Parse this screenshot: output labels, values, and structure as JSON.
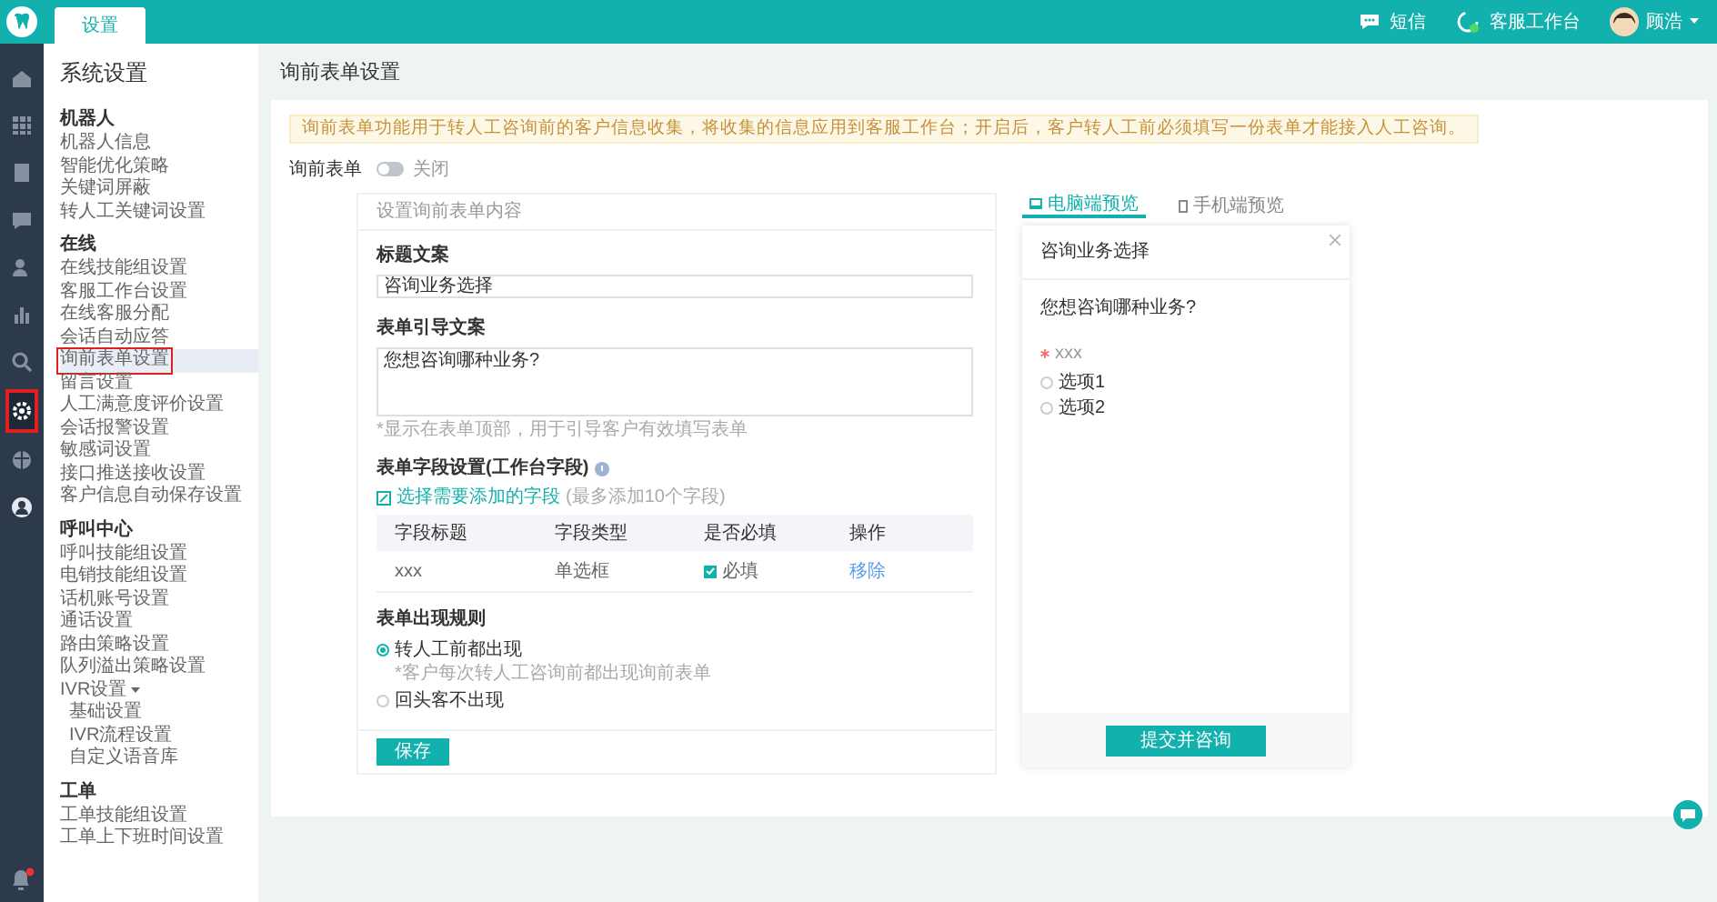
{
  "top_bar": {
    "tabs": [
      {
        "label": "设置",
        "selected": true
      }
    ],
    "actions": [
      {
        "label": "短信",
        "kind": "message"
      },
      {
        "label": "客服工作台",
        "kind": "workbench"
      }
    ],
    "user": {
      "name": "顾浩"
    }
  },
  "icon_rail": {
    "items": [
      {
        "kind": "home",
        "selected": false
      },
      {
        "kind": "grid",
        "selected": false
      },
      {
        "kind": "document",
        "selected": false
      },
      {
        "kind": "chat",
        "selected": false
      },
      {
        "kind": "people",
        "selected": false
      },
      {
        "kind": "chart",
        "selected": false
      },
      {
        "kind": "search",
        "selected": false
      },
      {
        "kind": "settings",
        "selected": true
      },
      {
        "kind": "globe",
        "selected": false
      },
      {
        "kind": "user",
        "selected": false
      }
    ],
    "notification": {
      "unread": true
    }
  },
  "sidebar": {
    "title": "系统设置",
    "groups": [
      {
        "title": "机器人",
        "items": [
          {
            "label": "机器人信息",
            "selected": false
          },
          {
            "label": "智能优化策略",
            "selected": false
          },
          {
            "label": "关键词屏蔽",
            "selected": false
          },
          {
            "label": "转人工关键词设置",
            "selected": false
          }
        ]
      },
      {
        "title": "在线",
        "items": [
          {
            "label": "在线技能组设置",
            "selected": false
          },
          {
            "label": "客服工作台设置",
            "selected": false
          },
          {
            "label": "在线客服分配",
            "selected": false
          },
          {
            "label": "会话自动应答",
            "selected": false
          },
          {
            "label": "询前表单设置",
            "selected": true
          },
          {
            "label": "留言设置",
            "selected": false
          },
          {
            "label": "人工满意度评价设置",
            "selected": false
          },
          {
            "label": "会话报警设置",
            "selected": false
          },
          {
            "label": "敏感词设置",
            "selected": false
          },
          {
            "label": "接口推送接收设置",
            "selected": false
          },
          {
            "label": "客户信息自动保存设置",
            "selected": false
          }
        ]
      },
      {
        "title": "呼叫中心",
        "items": [
          {
            "label": "呼叫技能组设置",
            "selected": false
          },
          {
            "label": "电销技能组设置",
            "selected": false
          },
          {
            "label": "话机账号设置",
            "selected": false
          },
          {
            "label": "通话设置",
            "selected": false
          },
          {
            "label": "路由策略设置",
            "selected": false
          },
          {
            "label": "队列溢出策略设置",
            "selected": false
          },
          {
            "label": "IVR设置",
            "selected": false,
            "expanded": true,
            "children": [
              {
                "label": "基础设置",
                "selected": false
              },
              {
                "label": "IVR流程设置",
                "selected": false
              },
              {
                "label": "自定义语音库",
                "selected": false
              }
            ]
          }
        ]
      },
      {
        "title": "工单",
        "items": [
          {
            "label": "工单技能组设置",
            "selected": false
          },
          {
            "label": "工单上下班时间设置",
            "selected": false
          }
        ]
      }
    ]
  },
  "page": {
    "title": "询前表单设置",
    "notice": "询前表单功能用于转人工咨询前的客户信息收集，将收集的信息应用到客服工作台；开启后，客户转人工前必须填写一份表单才能接入人工咨询。",
    "toggle": {
      "label": "询前表单",
      "on": false,
      "state_text": "关闭"
    },
    "form": {
      "header": "设置询前表单内容",
      "title_field": {
        "label": "标题文案",
        "value": "咨询业务选择"
      },
      "guide_field": {
        "label": "表单引导文案",
        "value": "您想咨询哪种业务?",
        "hint": "*显示在表单顶部，用于引导客户有效填写表单"
      },
      "fields_section": {
        "label": "表单字段设置(工作台字段)",
        "add_link": "选择需要添加的字段",
        "add_hint": "(最多添加10个字段)",
        "columns": [
          "字段标题",
          "字段类型",
          "是否必填",
          "操作"
        ],
        "rows": [
          {
            "title": "xxx",
            "type": "单选框",
            "required": true,
            "required_label": "必填",
            "action": "移除"
          }
        ]
      },
      "rules": {
        "label": "表单出现规则",
        "options": [
          {
            "label": "转人工前都出现",
            "selected": true,
            "hint": "*客户每次转人工咨询前都出现询前表单"
          },
          {
            "label": "回头客不出现",
            "selected": false
          }
        ]
      },
      "save_button": "保存"
    },
    "preview": {
      "tabs": [
        {
          "label": "电脑端预览",
          "kind": "desktop",
          "selected": true
        },
        {
          "label": "手机端预览",
          "kind": "mobile",
          "selected": false
        }
      ],
      "dialog": {
        "title": "咨询业务选择",
        "question": "您想咨询哪种业务?",
        "field_label": "xxx",
        "required": true,
        "options": [
          {
            "label": "选项1",
            "selected": false
          },
          {
            "label": "选项2",
            "selected": false
          }
        ],
        "submit": "提交并咨询"
      }
    }
  }
}
